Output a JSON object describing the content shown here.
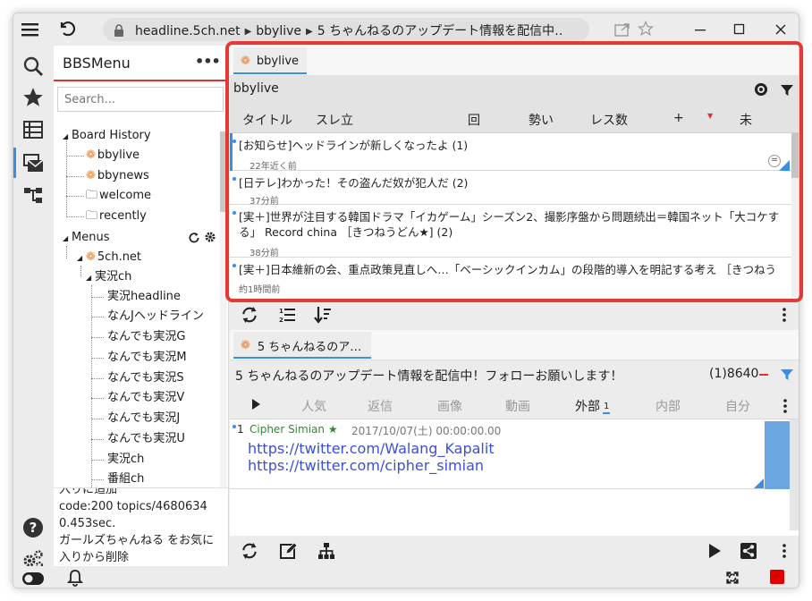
{
  "titlebar": {
    "url_host": "headline.5ch.net",
    "url_board": "bbylive",
    "url_thread": "5 ちゃんねるのアップデート情報を配信中…"
  },
  "sidebar": {
    "title": "BBSMenu",
    "more": "•••",
    "search_placeholder": "Search...",
    "board_history": "Board History",
    "history_items": [
      "bbylive",
      "bbynews",
      "welcome",
      "recently"
    ],
    "menus": "Menus",
    "fivech": "5ch.net",
    "jikkyo": "実況ch",
    "menu_items": [
      "実況headline",
      "なんJヘッドライン",
      "なんでも実況G",
      "なんでも実況M",
      "なんでも実況S",
      "なんでも実況V",
      "なんでも実況J",
      "なんでも実況U",
      "実況ch",
      "番組ch"
    ],
    "log_lines": [
      "入りに追加",
      "code:200 topics/4680634",
      "0.453sec.",
      "ガールズちゃんねる をお気に",
      "入りから削除"
    ]
  },
  "board_panel": {
    "tab_label": "bbylive",
    "board_name": "bbylive",
    "columns": [
      "タイトル",
      "スレ立",
      "回",
      "勢い",
      "レス数",
      "+",
      "未"
    ],
    "threads": [
      {
        "title": "[お知らせ]ヘッドラインが新しくなったよ (1)",
        "meta": "22年近く前"
      },
      {
        "title": "[日テレ]わかった！その盗んだ奴が犯人だ  (2)",
        "meta": "37分前"
      },
      {
        "title": "[実＋]世界が注目する韓国ドラマ「イカゲーム」シーズン2、撮影序盤から問題続出＝韓国ネット「大コケする」 Record china ［きつねうどん★] (2)",
        "meta": "38分前"
      },
      {
        "title": "[実＋]日本維新の会、重点政策見直しへ…「ベーシックインカム」の段階的導入を明記する考え ［きつねうどん",
        "meta": "約1時間前"
      }
    ]
  },
  "thread_panel": {
    "tab_label": "5 ちゃんねるのア…",
    "title": "5 ちゃんねるのアップデート情報を配信中！フォローお願いします！",
    "count": "(1)8640",
    "filters": [
      "人気",
      "返信",
      "画像",
      "動画",
      "外部",
      "内部",
      "自分"
    ],
    "external_count": "1",
    "post": {
      "number": "1",
      "name": "Cipher Simian ★",
      "date": "2017/10/07(土) 00:00:00.00",
      "links": [
        "https://twitter.com/Walang_Kapalit",
        "https://twitter.com/cipher_simian"
      ]
    }
  },
  "colors": {
    "highlight": "#e53935",
    "accent": "#3a8ee6",
    "post_name": "#2e8b2e",
    "link": "#3b4fd6",
    "stop": "#e00000"
  }
}
